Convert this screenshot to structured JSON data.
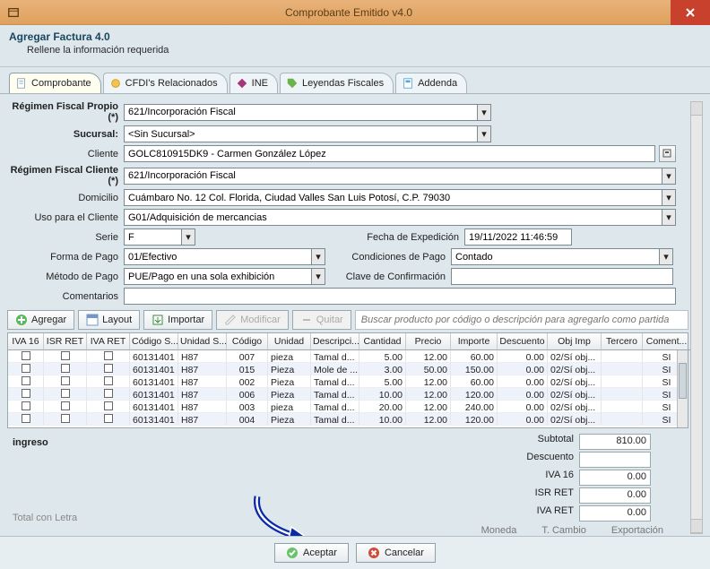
{
  "window": {
    "title": "Comprobante Emitido v4.0",
    "heading": "Agregar Factura 4.0",
    "subheading": "Rellene la información requerida"
  },
  "tabs": {
    "comprobante": "Comprobante",
    "cfdis": "CFDI's Relacionados",
    "ine": "INE",
    "leyendas": "Leyendas Fiscales",
    "addenda": "Addenda"
  },
  "form": {
    "regimen_propio_label": "Régimen Fiscal Propio (*)",
    "regimen_propio_value": "621/Incorporación Fiscal",
    "sucursal_label": "Sucursal:",
    "sucursal_value": "<Sin Sucursal>",
    "cliente_label": "Cliente",
    "cliente_value": "GOLC810915DK9 - Carmen González López",
    "regimen_cliente_label": "Régimen Fiscal Cliente (*)",
    "regimen_cliente_value": "621/Incorporación Fiscal",
    "domicilio_label": "Domicilio",
    "domicilio_value": "Cuámbaro No. 12 Col. Florida, Ciudad Valles San Luis Potosí, C.P. 79030",
    "uso_label": "Uso para el Cliente",
    "uso_value": "G01/Adquisición de mercancias",
    "serie_label": "Serie",
    "serie_value": "F",
    "fecha_label": "Fecha de Expedición",
    "fecha_value": "19/11/2022 11:46:59",
    "forma_label": "Forma de Pago",
    "forma_value": "01/Efectivo",
    "cond_label": "Condiciones de Pago",
    "cond_value": "Contado",
    "metodo_label": "Método de Pago",
    "metodo_value": "PUE/Pago en una sola exhibición",
    "clave_conf_label": "Clave de Confirmación",
    "clave_conf_value": "",
    "comentarios_label": "Comentarios",
    "comentarios_value": ""
  },
  "toolbar": {
    "agregar": "Agregar",
    "layout": "Layout",
    "importar": "Importar",
    "modificar": "Modificar",
    "quitar": "Quitar",
    "search_placeholder": "Buscar producto por código o descripción para agregarlo como partida"
  },
  "grid": {
    "columns": [
      "IVA 16",
      "ISR RET",
      "IVA RET",
      "Código S...",
      "Unidad S...",
      "Código",
      "Unidad",
      "Descripci...",
      "Cantidad",
      "Precio",
      "Importe",
      "Descuento",
      "Obj Imp",
      "Tercero",
      "Coment..."
    ],
    "rows": [
      {
        "codsat": "60131401",
        "usat": "H87",
        "cod": "007",
        "unidad": "pieza",
        "desc": "Tamal d...",
        "cant": "5.00",
        "precio": "12.00",
        "imp": "60.00",
        "dto": "0.00",
        "obj": "02/Sí obj...",
        "ter": "",
        "com": "SI"
      },
      {
        "codsat": "60131401",
        "usat": "H87",
        "cod": "015",
        "unidad": "Pieza",
        "desc": "Mole de ...",
        "cant": "3.00",
        "precio": "50.00",
        "imp": "150.00",
        "dto": "0.00",
        "obj": "02/Sí obj...",
        "ter": "",
        "com": "SI"
      },
      {
        "codsat": "60131401",
        "usat": "H87",
        "cod": "002",
        "unidad": "Pieza",
        "desc": "Tamal d...",
        "cant": "5.00",
        "precio": "12.00",
        "imp": "60.00",
        "dto": "0.00",
        "obj": "02/Sí obj...",
        "ter": "",
        "com": "SI"
      },
      {
        "codsat": "60131401",
        "usat": "H87",
        "cod": "006",
        "unidad": "Pieza",
        "desc": "Tamal d...",
        "cant": "10.00",
        "precio": "12.00",
        "imp": "120.00",
        "dto": "0.00",
        "obj": "02/Sí obj...",
        "ter": "",
        "com": "SI"
      },
      {
        "codsat": "60131401",
        "usat": "H87",
        "cod": "003",
        "unidad": "pieza",
        "desc": "Tamal d...",
        "cant": "20.00",
        "precio": "12.00",
        "imp": "240.00",
        "dto": "0.00",
        "obj": "02/Sí obj...",
        "ter": "",
        "com": "SI"
      },
      {
        "codsat": "60131401",
        "usat": "H87",
        "cod": "004",
        "unidad": "Pieza",
        "desc": "Tamal d...",
        "cant": "10.00",
        "precio": "12.00",
        "imp": "120.00",
        "dto": "0.00",
        "obj": "02/Sí obj...",
        "ter": "",
        "com": "SI"
      }
    ]
  },
  "totals": {
    "ingreso_label": "ingreso",
    "subtotal_label": "Subtotal",
    "subtotal_value": "810.00",
    "descuento_label": "Descuento",
    "descuento_value": "",
    "iva16_label": "IVA 16",
    "iva16_value": "0.00",
    "isrret_label": "ISR RET",
    "isrret_value": "0.00",
    "ivaret_label": "IVA RET",
    "ivaret_value": "0.00",
    "total_letra_label": "Total con Letra",
    "footer_labels": {
      "moneda": "Moneda",
      "tcambio": "T. Cambio",
      "exportacion": "Exportación"
    }
  },
  "buttons": {
    "aceptar": "Aceptar",
    "cancelar": "Cancelar"
  }
}
